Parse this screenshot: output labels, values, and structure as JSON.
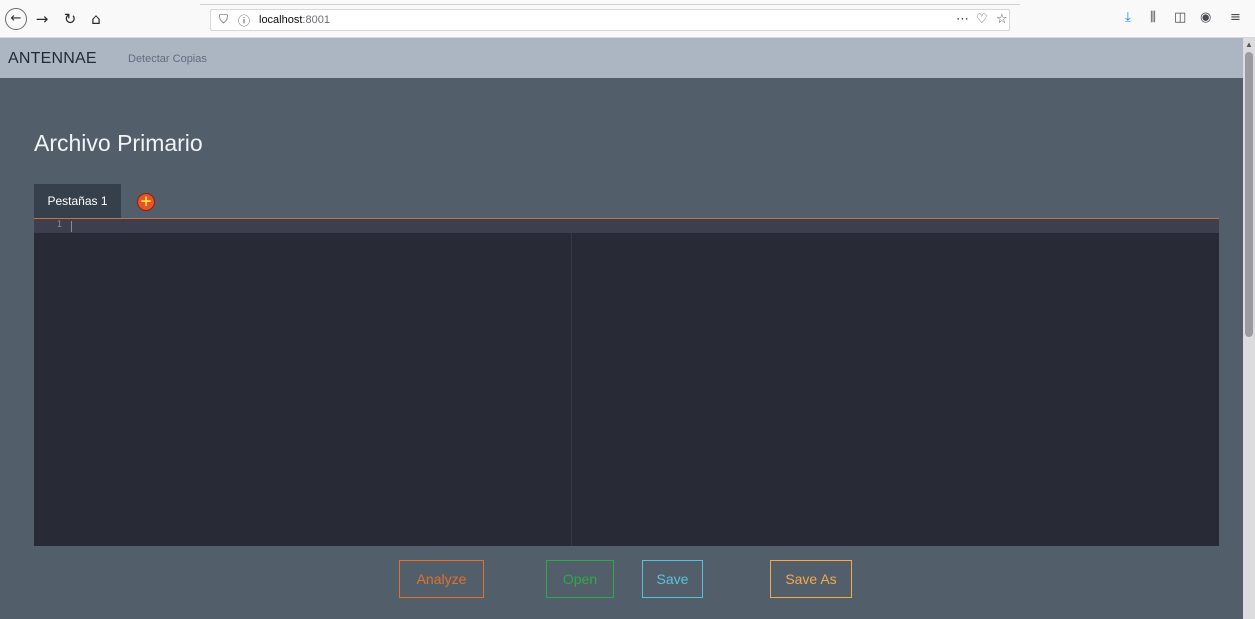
{
  "browser": {
    "url_host": "localhost",
    "url_port": ":8001",
    "icons": {
      "back": "back-arrow-icon",
      "forward": "forward-arrow-icon",
      "reload": "reload-icon",
      "home": "home-icon",
      "tracking": "shield-icon",
      "info": "info-icon",
      "page_actions": "ellipsis-icon",
      "pocket": "pocket-icon",
      "bookmark": "star-icon",
      "download": "download-icon",
      "library": "library-icon",
      "sidebar": "sidebar-icon",
      "account": "account-icon",
      "menu": "hamburger-menu-icon"
    }
  },
  "navbar": {
    "brand": "ANTENNAE",
    "link": "Detectar Copias"
  },
  "main": {
    "title": "Archivo Primario",
    "tabs": [
      {
        "label": "Pestañas 1"
      }
    ],
    "editor": {
      "line_numbers": [
        "1"
      ],
      "content": ""
    }
  },
  "actions": {
    "analyze": "Analyze",
    "open": "Open",
    "save": "Save",
    "save_as": "Save As"
  },
  "colors": {
    "page_bg": "#525f6b",
    "navbar_bg": "#abb6c2",
    "editor_bg": "#282a35",
    "analyze": "#e0702c",
    "open": "#2ea84a",
    "save": "#5bc0de",
    "save_as": "#f5a94a"
  }
}
